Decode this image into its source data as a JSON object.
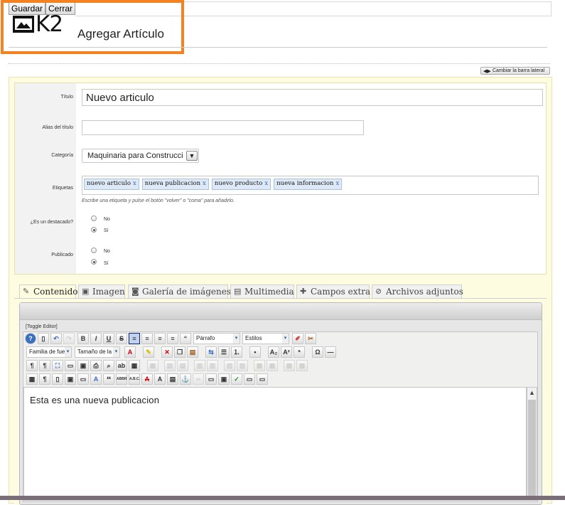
{
  "toolbar": {
    "save_label": "Guardar",
    "close_label": "Cerrar"
  },
  "logo_text": "K2",
  "page_title": "Agregar Artículo",
  "sidebar_toggle_label": "Cambiar la barra lateral",
  "form": {
    "title_label": "Título",
    "title_value": "Nuevo articulo",
    "alias_label": "Alias del título",
    "alias_value": "",
    "category_label": "Categoría",
    "category_value": "Maquinaria para Construcci",
    "tags_label": "Etiquetas",
    "tags": [
      {
        "text": "nuevo articulo",
        "remove": "x"
      },
      {
        "text": "nueva publicacion",
        "remove": "x"
      },
      {
        "text": "nuevo producto",
        "remove": "x"
      },
      {
        "text": "nueva informacion",
        "remove": "x"
      }
    ],
    "tags_hint": "Escribe una etiqueta y pulse el botón \"volver\" o \"coma\" para añadirlo.",
    "featured_label": "¿Es un destacado?",
    "published_label": "Publicado",
    "option_no": "No",
    "option_yes": "Sí",
    "featured_value": "Sí",
    "published_value": "Sí"
  },
  "tabs": [
    {
      "label": "Contenido",
      "icon": "edit-icon",
      "active": true
    },
    {
      "label": "Imagen",
      "icon": "image-icon",
      "active": false
    },
    {
      "label": "Galería de imágenes",
      "icon": "camera-icon",
      "active": false
    },
    {
      "label": "Multimedia",
      "icon": "film-icon",
      "active": false
    },
    {
      "label": "Campos extra",
      "icon": "fields-icon",
      "active": false
    },
    {
      "label": "Archivos adjuntos",
      "icon": "paperclip-icon",
      "active": false
    }
  ],
  "editor": {
    "toggle_label": "[Toggle Editor]",
    "format_value": "Párrafo",
    "styles_value": "Estilos",
    "font_family_value": "Familia de fuer",
    "font_size_value": "Tamaño de la f",
    "content": "Esta es una nueva publicacion"
  }
}
